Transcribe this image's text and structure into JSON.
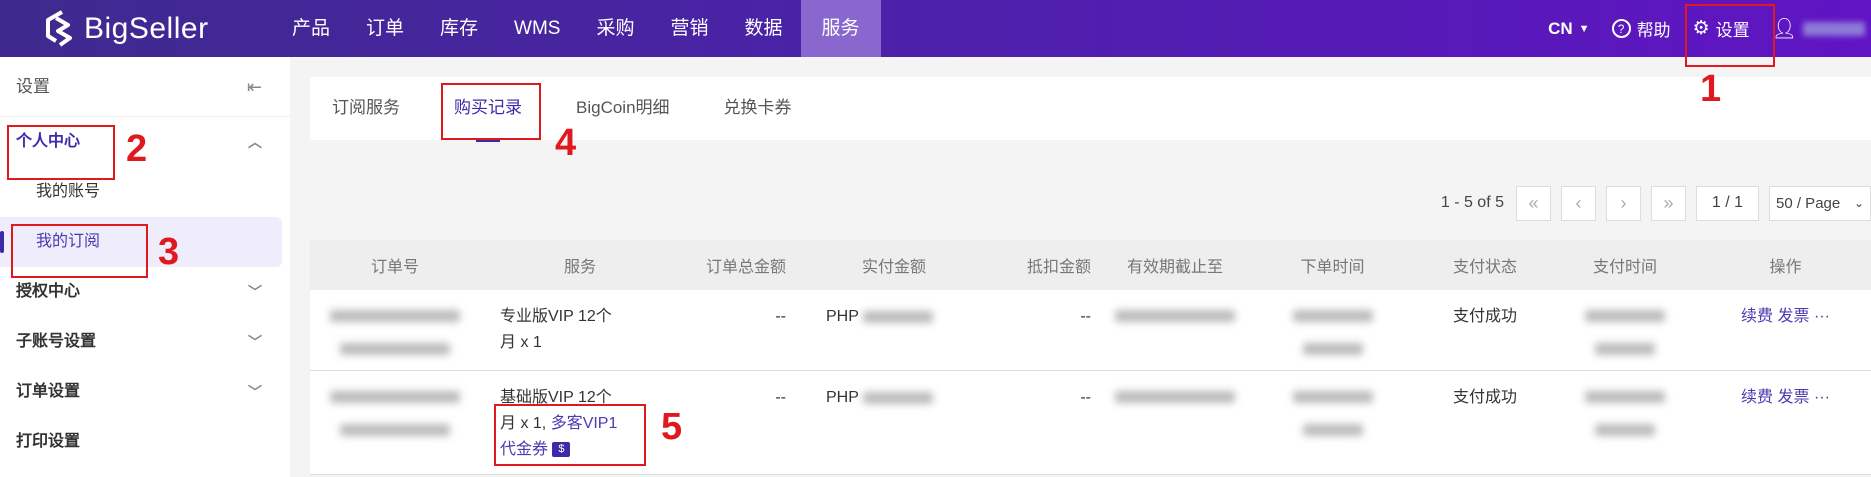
{
  "header": {
    "brand": "BigSeller",
    "nav": [
      "产品",
      "订单",
      "库存",
      "WMS",
      "采购",
      "营销",
      "数据",
      "服务"
    ],
    "active_nav": "服务",
    "lang": "CN",
    "help": "帮助",
    "settings": "设置"
  },
  "sidebar": {
    "title": "设置",
    "groups": [
      {
        "label": "个人中心",
        "open": true,
        "items": [
          "我的账号",
          "我的订阅"
        ],
        "selected": "我的订阅"
      },
      {
        "label": "授权中心"
      },
      {
        "label": "子账号设置"
      },
      {
        "label": "订单设置"
      },
      {
        "label": "打印设置"
      }
    ]
  },
  "tabs": [
    "订阅服务",
    "购买记录",
    "BigCoin明细",
    "兑换卡券"
  ],
  "active_tab": "购买记录",
  "pagination": {
    "summary": "1 - 5 of 5",
    "page": "1 / 1",
    "page_size": "50 / Page"
  },
  "table": {
    "columns": [
      "订单号",
      "服务",
      "订单总金额",
      "实付金额",
      "抵扣金额",
      "有效期截止至",
      "下单时间",
      "支付状态",
      "支付时间",
      "操作"
    ],
    "rows": [
      {
        "service": "专业版VIP 12个月 x 1",
        "total": "--",
        "currency": "PHP",
        "deduct": "--",
        "status": "支付成功"
      },
      {
        "service": "基础版VIP 12个月 x 1, ",
        "service_link": "多客VIP1代金券",
        "coupon_icon": "$",
        "total": "--",
        "currency": "PHP",
        "deduct": "--",
        "status": "支付成功"
      }
    ],
    "actions": {
      "renew": "续费",
      "invoice": "发票",
      "more": "···"
    }
  },
  "annotations": [
    "1",
    "2",
    "3",
    "4",
    "5"
  ],
  "colors": {
    "accent": "#3e2aa8",
    "annotation": "#e0191f"
  }
}
